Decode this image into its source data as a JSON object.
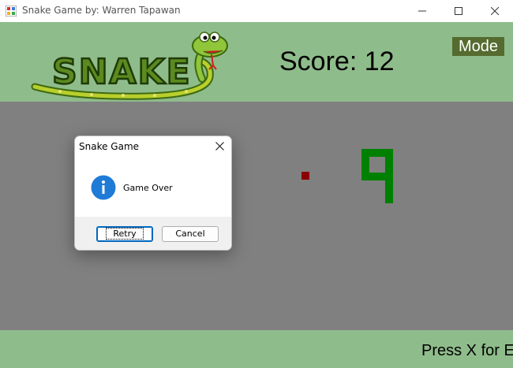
{
  "window": {
    "title": "Snake Game by: Warren Tapawan",
    "buttons": [
      "minimize-icon",
      "maximize-icon",
      "close-icon"
    ]
  },
  "header": {
    "logo_text": "SNAKE",
    "score_text": "Score: 12",
    "mode_label": "Mode"
  },
  "board": {
    "background": "#808080",
    "snake_color": "#008000",
    "food_color": "#8b0000"
  },
  "footer": {
    "hint_text": "Press X for E"
  },
  "dialog": {
    "title": "Snake Game",
    "icon": "info-icon",
    "message": "Game Over",
    "retry_label": "Retry",
    "cancel_label": "Cancel"
  },
  "colors": {
    "header_bg": "#8fbc8b",
    "mode_button_bg": "#556b2f"
  }
}
